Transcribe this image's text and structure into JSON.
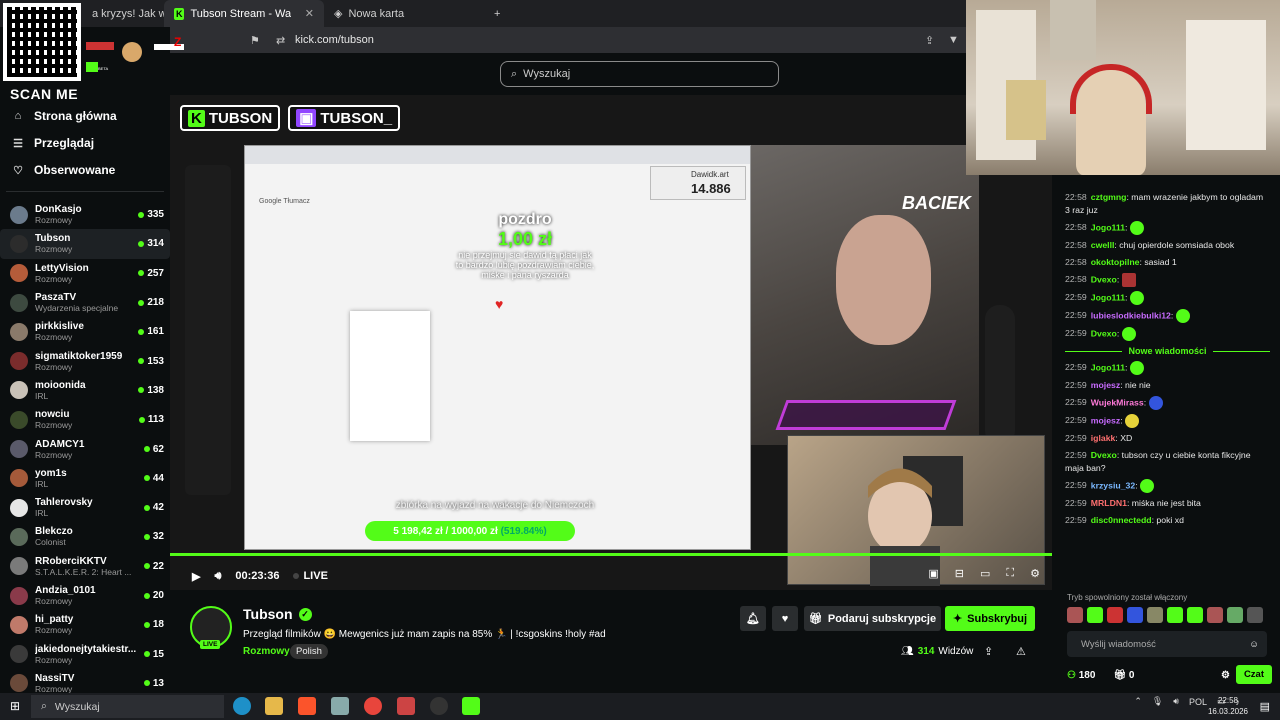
{
  "browser": {
    "tabs": [
      {
        "label": "a kryzys! Jak wojna w...",
        "active": false
      },
      {
        "label": "Tubson Stream - Watch Live on K",
        "active": true
      },
      {
        "label": "Nowa karta",
        "active": false
      }
    ],
    "url": "kick.com/tubson",
    "new_tab": "+"
  },
  "overlay": {
    "scan_me": "SCAN ME",
    "sticker_text": "BETA"
  },
  "search": {
    "placeholder": "Wyszukaj"
  },
  "nav": {
    "home": "Strona główna",
    "browse": "Przeglądaj",
    "following": "Obserwowane"
  },
  "channels": [
    {
      "name": "DonKasjo",
      "category": "Rozmowy",
      "viewers": "335",
      "color": "#6b7b8c"
    },
    {
      "name": "Tubson",
      "category": "Rozmowy",
      "viewers": "314",
      "color": "#2c2c2c"
    },
    {
      "name": "LettyVision",
      "category": "Rozmowy",
      "viewers": "257",
      "color": "#b55c3a"
    },
    {
      "name": "PaszaTV",
      "category": "Wydarzenia specjalne",
      "viewers": "218",
      "color": "#3d4a40"
    },
    {
      "name": "pirkkislive",
      "category": "Rozmowy",
      "viewers": "161",
      "color": "#8a7a6a"
    },
    {
      "name": "sigmatiktoker1959",
      "category": "Rozmowy",
      "viewers": "153",
      "color": "#7a2c2c"
    },
    {
      "name": "moioonida",
      "category": "IRL",
      "viewers": "138",
      "color": "#c9c2b8"
    },
    {
      "name": "nowciu",
      "category": "Rozmowy",
      "viewers": "113",
      "color": "#3a4a2a"
    },
    {
      "name": "ADAMCY1",
      "category": "Rozmowy",
      "viewers": "62",
      "color": "#5a5a6a"
    },
    {
      "name": "yom1s",
      "category": "IRL",
      "viewers": "44",
      "color": "#a55a3a"
    },
    {
      "name": "Tahlerovsky",
      "category": "IRL",
      "viewers": "42",
      "color": "#e6e6e6"
    },
    {
      "name": "Blekczo",
      "category": "Colonist",
      "viewers": "32",
      "color": "#5a6a5a"
    },
    {
      "name": "RRoberciKKTV",
      "category": "S.T.A.L.K.E.R. 2: Heart ...",
      "viewers": "22",
      "color": "#7a7a7a"
    },
    {
      "name": "Andzia_0101",
      "category": "Rozmowy",
      "viewers": "20",
      "color": "#8a3a4a"
    },
    {
      "name": "hi_patty",
      "category": "Rozmowy",
      "viewers": "18",
      "color": "#c07a6a"
    },
    {
      "name": "jakiedonejtytakiestr...",
      "category": "Rozmowy",
      "viewers": "15",
      "color": "#3a3a3a"
    },
    {
      "name": "NassiTV",
      "category": "Rozmowy",
      "viewers": "13",
      "color": "#6a4a3a"
    }
  ],
  "video": {
    "logo_kick": "TUBSON",
    "logo_twitch": "TUBSON_",
    "donation_name": "pozdro",
    "donation_amount": "1,00 zł",
    "donation_msg": "nie przejmuj sie dawid tą płaci jak to bardzo lubię pozdrawiam ciebie, miśke i pana ryszarda",
    "donation_widget_name": "Dawidk.art",
    "donation_widget_number": "14.886",
    "gt_title": "Google Tłumacz",
    "goal_label": "zbiórka na wyjazd na wakacje do Niemczoch",
    "goal_value": "5 198,42 zł / 1000,00 zł",
    "goal_percent": "(519.84%)",
    "cam_label": "BACIEK",
    "time": "00:23:36",
    "live": "LIVE"
  },
  "stream": {
    "name": "Tubson",
    "live_badge": "LIVE",
    "title": "Przegląd filmików 😀 Mewgenics już mam zapis na 85% 🏃 | !csgoskins !holy #ad",
    "category": "Rozmowy",
    "tag": "Polish",
    "gift_label": "Podaruj subskrypcje",
    "sub_label": "Subskrybuj",
    "viewers_count": "314",
    "viewers_label": "Widzów"
  },
  "chat": {
    "messages": [
      {
        "time": "22:58",
        "user": "cztgmng",
        "color": "#53fc18",
        "text": "mam wrazenie jakbym to ogladam 3 raz juz",
        "emote": ""
      },
      {
        "time": "22:58",
        "user": "Jogo111",
        "color": "#53fc18",
        "text": "",
        "emote": "green"
      },
      {
        "time": "22:58",
        "user": "cwelll",
        "color": "#53fc18",
        "text": "chuj opierdole somsiada obok",
        "emote": ""
      },
      {
        "time": "22:58",
        "user": "okoktopilne",
        "color": "#53fc18",
        "text": "sasiad 1",
        "emote": ""
      },
      {
        "time": "22:58",
        "user": "Dvexo",
        "color": "#53fc18",
        "text": "",
        "emote": "red"
      },
      {
        "time": "22:59",
        "user": "Jogo111",
        "color": "#53fc18",
        "text": "",
        "emote": "green"
      },
      {
        "time": "22:59",
        "user": "lubieslodkiebulki12",
        "color": "#c86bff",
        "text": "",
        "emote": "green"
      },
      {
        "time": "22:59",
        "user": "Dvexo",
        "color": "#53fc18",
        "text": "",
        "emote": "green"
      }
    ],
    "new_messages": "Nowe wiadomości",
    "messages_after": [
      {
        "time": "22:59",
        "user": "Jogo111",
        "color": "#53fc18",
        "text": "",
        "emote": "green"
      },
      {
        "time": "22:59",
        "user": "mojesz",
        "color": "#c86bff",
        "text": "nie nie",
        "emote": ""
      },
      {
        "time": "22:59",
        "user": "WujekMirass",
        "color": "#ff7ad9",
        "text": "",
        "emote": "blue"
      },
      {
        "time": "22:59",
        "user": "mojesz",
        "color": "#c86bff",
        "text": "",
        "emote": "yellow"
      },
      {
        "time": "22:59",
        "user": "iglakk",
        "color": "#ff7070",
        "text": "XD",
        "emote": ""
      },
      {
        "time": "22:59",
        "user": "Dvexo",
        "color": "#53fc18",
        "text": "tubson czy u ciebie konta fikcyjne maja ban?",
        "emote": ""
      },
      {
        "time": "22:59",
        "user": "krzysiu_32",
        "color": "#7ab8ff",
        "text": "",
        "emote": "green"
      },
      {
        "time": "22:59",
        "user": "MRLDN1",
        "color": "#ff7070",
        "text": "miśka nie jest bita",
        "emote": ""
      },
      {
        "time": "22:59",
        "user": "disc0nnectedd",
        "color": "#53fc18",
        "text": "poki xd",
        "emote": ""
      }
    ],
    "slow_mode": "Tryb spowolniony został włączony",
    "input_placeholder": "Wyślij wiadomość",
    "points": "180",
    "gifts": "0",
    "send_label": "Czat"
  },
  "taskbar": {
    "search": "Wyszukaj",
    "lang": "POL",
    "time": "22:58",
    "date": "16.03.2026"
  }
}
